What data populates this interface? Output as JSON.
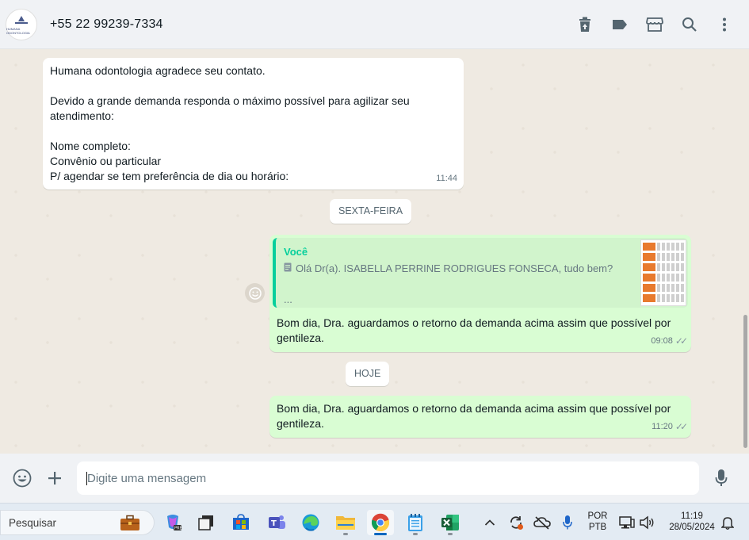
{
  "header": {
    "contact_name": "+55 22 99239-7334",
    "avatar_label": "HUMANA ODONTOLOGIA"
  },
  "messages": {
    "incoming_1": {
      "text": "Humana odontologia agradece seu contato.\n\nDevido a grande demanda responda o máximo possível para agilizar seu atendimento:\n\nNome completo:\nConvênio ou particular\nP/ agendar se tem preferência de dia ou horário:",
      "time": "11:44"
    },
    "date_chip_1": "SEXTA-FEIRA",
    "outgoing_1": {
      "quote_author": "Você",
      "quote_text": "Olá Dr(a). ISABELLA PERRINE RODRIGUES FONSECA, tudo bem?",
      "quote_more": "...",
      "text": "Bom dia, Dra. aguardamos o retorno da demanda acima assim que possível por gentileza.",
      "time": "09:08"
    },
    "date_chip_2": "HOJE",
    "outgoing_2": {
      "text": "Bom dia, Dra. aguardamos o retorno da demanda acima assim que possível por gentileza.",
      "time": "11:20"
    }
  },
  "composer": {
    "placeholder": "Digite uma mensagem"
  },
  "taskbar": {
    "search_placeholder": "Pesquisar",
    "lang_line1": "POR",
    "lang_line2": "PTB",
    "clock_time": "11:19",
    "clock_date": "28/05/2024"
  },
  "colors": {
    "outgoing_bubble": "#d9fdd3",
    "incoming_bubble": "#ffffff",
    "quote_accent": "#06cf9c",
    "chat_background": "#efeae2"
  }
}
